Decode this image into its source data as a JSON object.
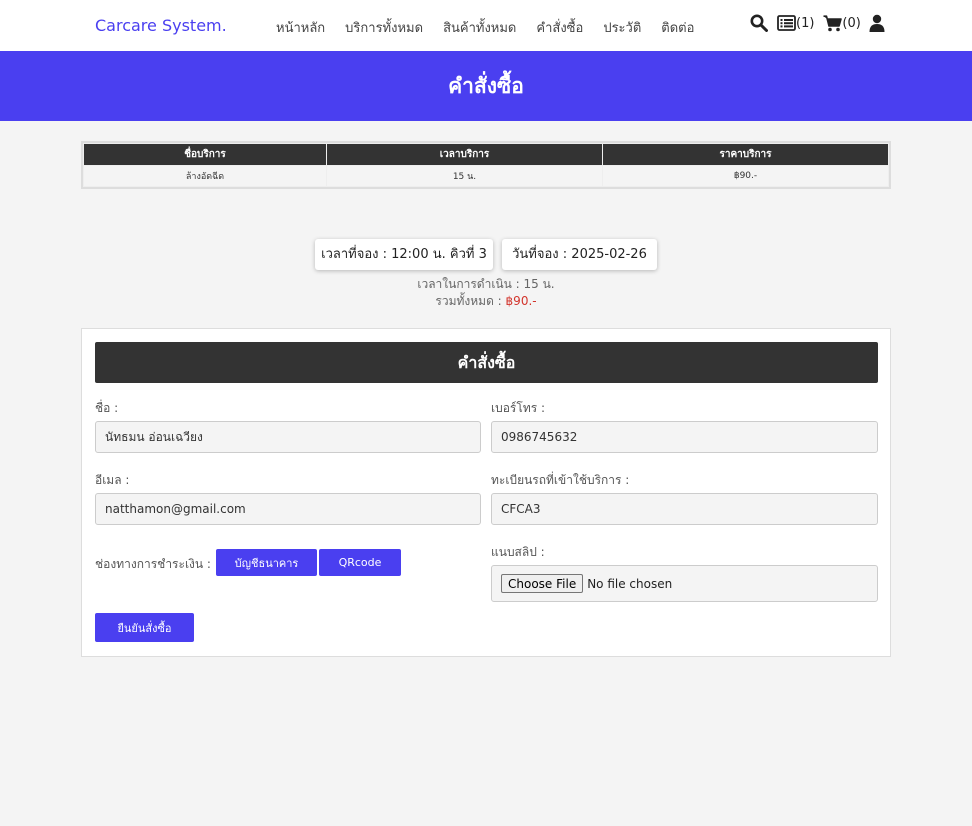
{
  "nav": {
    "brand": "Carcare System.",
    "menu": [
      "หน้าหลัก",
      "บริการทั้งหมด",
      "สินค้าทั้งหมด",
      "คำสั่งซื้อ",
      "ประวัติ",
      "ติดต่อ"
    ],
    "orders_count": "(1)",
    "cart_count": "(0)",
    "icons": [
      "search-icon",
      "list-icon",
      "cart-icon",
      "user-icon"
    ]
  },
  "banner": {
    "title": "คำสั่งซื้อ"
  },
  "summary_table": {
    "headers": [
      "ชื่อบริการ",
      "เวลาบริการ",
      "ราคาบริการ"
    ],
    "rows": [
      [
        "ล้างอัดฉีด",
        "15 น.",
        "฿90.-"
      ]
    ]
  },
  "booking": {
    "time_queue": "เวลาที่จอง : 12:00 น. คิวที่ 3",
    "date": "วันที่จอง : 2025-02-26",
    "duration": "เวลาในการดำเนิน : 15 น.",
    "total_label": "รวมทั้งหมด : ",
    "total_value": "฿90.-"
  },
  "order_form": {
    "title": "คำสั่งซื้อ",
    "name_label": "ชื่อ :",
    "name_value": "นัทธมน อ่อนเฉวียง",
    "phone_label": "เบอร์โทร :",
    "phone_value": "0986745632",
    "email_label": "อีเมล :",
    "email_value": "natthamon@gmail.com",
    "plate_label": "ทะเบียนรถที่เข้าใช้บริการ :",
    "plate_value": "CFCA3",
    "payment_label": "ช่องทางการชำระเงิน :",
    "payment_bank": "บัญชีธนาคาร",
    "payment_qr": "QRcode",
    "slip_label": "แนบสลิป :",
    "file_button": "Choose File",
    "file_status": "No file chosen",
    "submit": "ยืนยันสั่งซื้อ"
  },
  "colors": {
    "accent": "#4a3ff0",
    "dark": "#333333",
    "price": "#d2342c",
    "background": "#f4f4f4"
  }
}
